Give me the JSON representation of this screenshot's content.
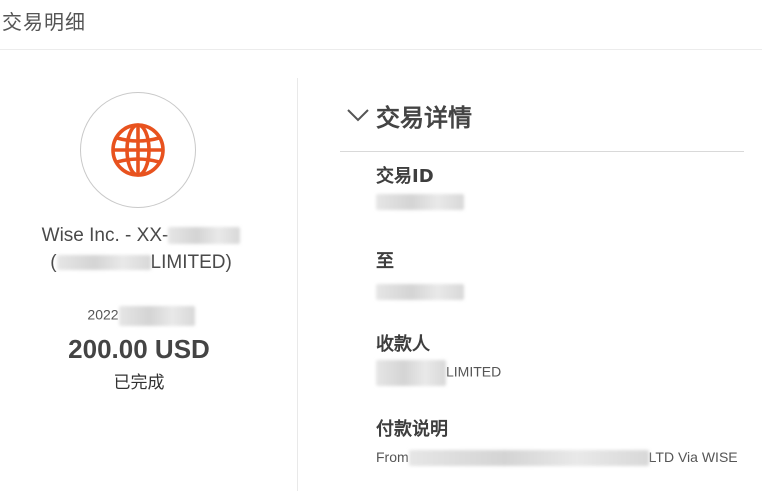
{
  "header": {
    "title": "交易明细"
  },
  "summary": {
    "icon": "globe-icon",
    "icon_color": "#e8521e",
    "payee_line1": "Wise Inc. - XX-",
    "payee_line2_open": "(",
    "payee_line2_suffix": "LIMITED)",
    "date_prefix": "2022",
    "amount": "200.00 USD",
    "status": "已完成"
  },
  "details": {
    "section_title": "交易详情",
    "fields": [
      {
        "label": "交易ID",
        "value": ""
      },
      {
        "label": "至",
        "value": ""
      },
      {
        "label": "收款人",
        "value_suffix": "LIMITED"
      },
      {
        "label": "付款说明",
        "value_prefix": "From",
        "value_suffix": "LTD Via WISE"
      }
    ]
  }
}
